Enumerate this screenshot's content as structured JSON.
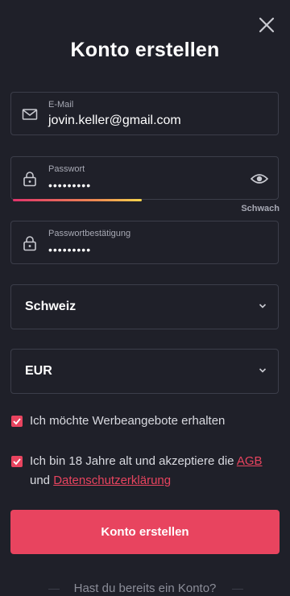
{
  "header": {
    "title": "Konto erstellen",
    "close_icon": "close-icon"
  },
  "form": {
    "email": {
      "label": "E-Mail",
      "value": "jovin.keller@gmail.com",
      "icon": "mail-icon"
    },
    "password": {
      "label": "Passwort",
      "value": "•••••••••",
      "icon": "lock-icon",
      "toggle_icon": "eye-icon",
      "strength_label": "Schwach"
    },
    "password_confirm": {
      "label": "Passwortbestätigung",
      "value": "•••••••••",
      "icon": "lock-icon"
    },
    "country": {
      "value": "Schweiz",
      "icon": "chevron-down-icon"
    },
    "currency": {
      "value": "EUR",
      "icon": "chevron-down-icon"
    },
    "offers_checkbox": {
      "label": "Ich möchte Werbeangebote erhalten",
      "checked": true
    },
    "terms_checkbox": {
      "text_before": "Ich bin 18 Jahre alt und akzeptiere die ",
      "agb_link": "AGB",
      "text_middle": "und ",
      "privacy_link": "Datenschutzerklärung",
      "checked": true
    },
    "submit_label": "Konto erstellen"
  },
  "footer": {
    "login_hint": "Hast du bereits ein Konto?"
  },
  "colors": {
    "background": "#1f2029",
    "accent": "#e8445f",
    "border": "#3c3e4a"
  }
}
